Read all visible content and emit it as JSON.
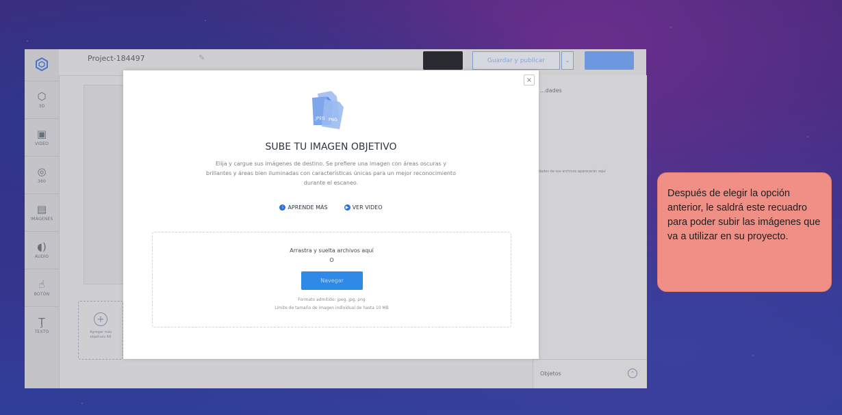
{
  "app": {
    "project_name": "Project-184497",
    "save_label": "Guardar y publicar",
    "sidebar": [
      {
        "icon": "cube-icon",
        "label": "3D"
      },
      {
        "icon": "video-icon",
        "label": "VIDEO"
      },
      {
        "icon": "360-icon",
        "label": "360"
      },
      {
        "icon": "images-icon",
        "label": "IMÁGENES"
      },
      {
        "icon": "audio-icon",
        "label": "AUDIO"
      },
      {
        "icon": "button-icon",
        "label": "BOTÓN"
      },
      {
        "icon": "text-icon",
        "label": "TEXTO"
      }
    ],
    "add_objects_label": "Agregar más objetivos AR",
    "right_panel_title": "...dades",
    "right_panel_note": "...edades de sus archivos aparecerán aquí",
    "objects_label": "Objetos"
  },
  "modal": {
    "close": "×",
    "hero_badges": [
      "JPEG",
      "PNG"
    ],
    "title": "SUBE TU IMAGEN OBJETIVO",
    "description": "Elija y cargue sus imágenes de destino. Se prefiere una imagen con áreas oscuras y brillantes y áreas bien iluminadas con características únicas para un mejor reconocimiento durante el escaneo.",
    "links": [
      "APRENDE MÁS",
      "VER VIDEO"
    ],
    "dropzone": {
      "drag_text": "Arrastra y suelta archivos aquí",
      "or": "O",
      "browse": "Navegar",
      "formats": "Formato admitido: jpeg, jpg, png",
      "limit": "Límite de tamaño de imagen individual de hasta 10 MB"
    }
  },
  "callout": {
    "text": "Después de elegir la opción anterior, le saldrá este recuadro para poder subir las imágenes que va a utilizar en su proyecto."
  },
  "colors": {
    "accent": "#2e8ae6",
    "callout_bg": "#ef8f86"
  }
}
